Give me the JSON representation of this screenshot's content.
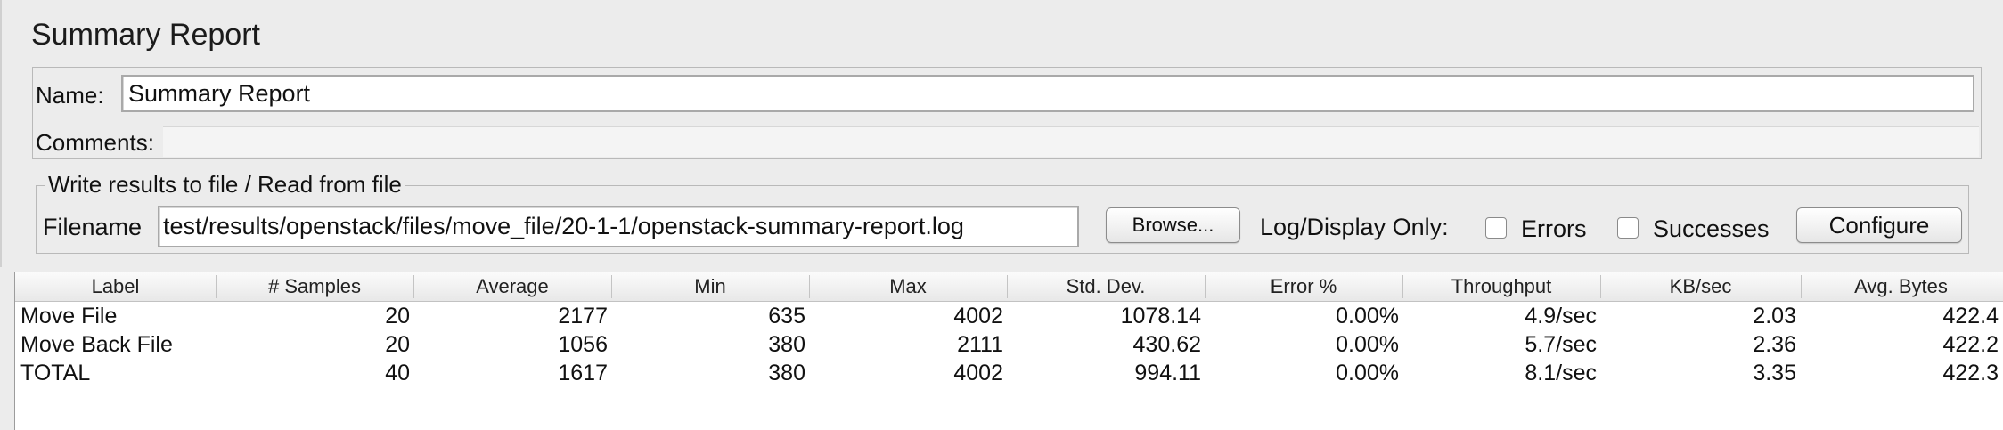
{
  "title": "Summary Report",
  "name": {
    "label": "Name:",
    "value": "Summary Report"
  },
  "comments": {
    "label": "Comments:",
    "value": ""
  },
  "file_section": {
    "legend": "Write results to file / Read from file",
    "filename_label": "Filename",
    "filename_value": "test/results/openstack/files/move_file/20-1-1/openstack-summary-report.log",
    "browse_label": "Browse...",
    "log_display_label": "Log/Display Only:",
    "errors_label": "Errors",
    "successes_label": "Successes",
    "configure_label": "Configure"
  },
  "table": {
    "headers": [
      "Label",
      "# Samples",
      "Average",
      "Min",
      "Max",
      "Std. Dev.",
      "Error %",
      "Throughput",
      "KB/sec",
      "Avg. Bytes"
    ],
    "rows": [
      [
        "Move File",
        "20",
        "2177",
        "635",
        "4002",
        "1078.14",
        "0.00%",
        "4.9/sec",
        "2.03",
        "422.4"
      ],
      [
        "Move Back File",
        "20",
        "1056",
        "380",
        "2111",
        "430.62",
        "0.00%",
        "5.7/sec",
        "2.36",
        "422.2"
      ],
      [
        "TOTAL",
        "40",
        "1617",
        "380",
        "4002",
        "994.11",
        "0.00%",
        "8.1/sec",
        "3.35",
        "422.3"
      ]
    ]
  }
}
